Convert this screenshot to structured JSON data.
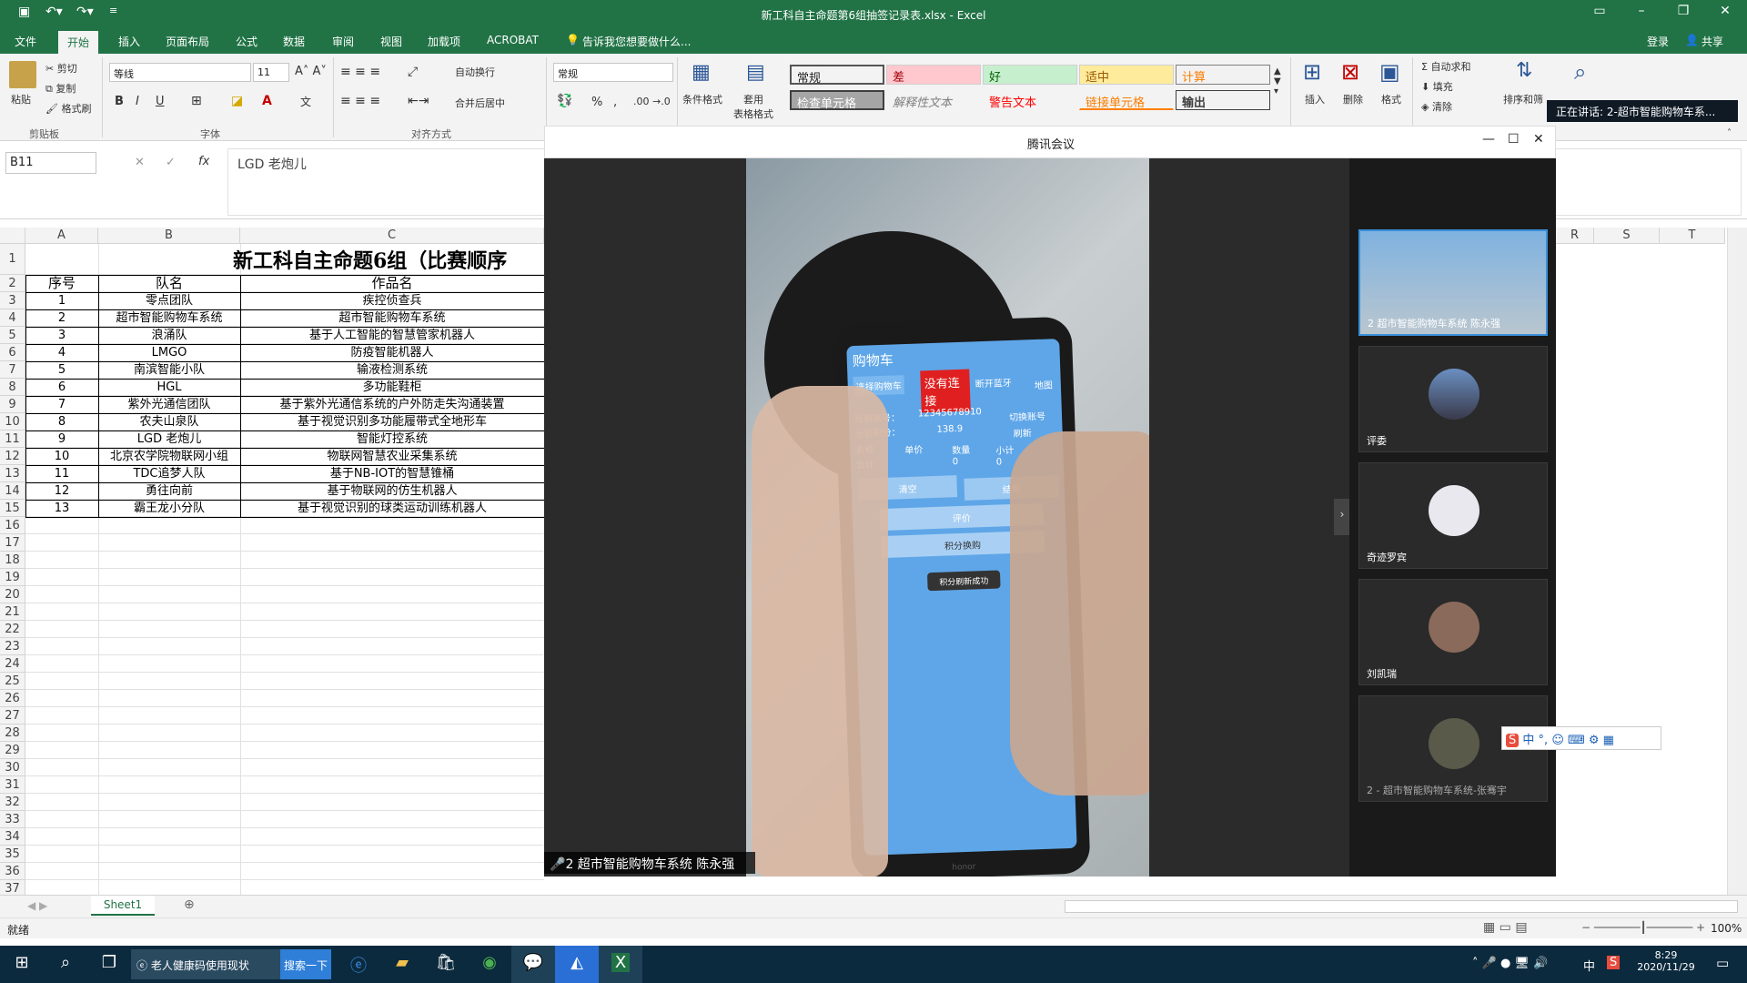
{
  "window": {
    "title": "新工科自主命题第6组抽签记录表.xlsx - Excel"
  },
  "tabs": [
    "文件",
    "开始",
    "插入",
    "页面布局",
    "公式",
    "数据",
    "审阅",
    "视图",
    "加载项",
    "ACROBAT"
  ],
  "tell_me": "告诉我您想要做什么...",
  "account": {
    "login": "登录",
    "share": "共享"
  },
  "ribbon": {
    "clipboard": {
      "paste": "粘贴",
      "cut": "剪切",
      "copy": "复制",
      "format_painter": "格式刷",
      "group": "剪贴板"
    },
    "font": {
      "name": "等线",
      "size": "11",
      "group": "字体",
      "bold": "B",
      "italic": "I",
      "underline": "U"
    },
    "alignment": {
      "wrap": "自动换行",
      "merge": "合并后居中",
      "group": "对齐方式"
    },
    "number": {
      "format": "常规",
      "percent": "%",
      "comma": ","
    },
    "styles": {
      "cond": "条件格式",
      "table": "套用\n表格格式",
      "items": [
        {
          "label": "常规",
          "bg": "#ffffff",
          "fg": "#000000"
        },
        {
          "label": "差",
          "bg": "#ffc7ce",
          "fg": "#9c0006"
        },
        {
          "label": "好",
          "bg": "#c6efce",
          "fg": "#006100"
        },
        {
          "label": "适中",
          "bg": "#ffeb9c",
          "fg": "#9c5700"
        },
        {
          "label": "计算",
          "bg": "#f2f2f2",
          "fg": "#fa7d00"
        },
        {
          "label": "检查单元格",
          "bg": "#a5a5a5",
          "fg": "#ffffff"
        },
        {
          "label": "解释性文本",
          "bg": "#ffffff",
          "fg": "#7f7f7f"
        },
        {
          "label": "警告文本",
          "bg": "#ffffff",
          "fg": "#ff0000"
        },
        {
          "label": "链接单元格",
          "bg": "#ffffff",
          "fg": "#fa7d00"
        },
        {
          "label": "输出",
          "bg": "#f2f2f2",
          "fg": "#3f3f3f"
        }
      ]
    },
    "cells": {
      "insert": "插入",
      "delete": "删除",
      "format": "格式"
    },
    "editing": {
      "autosum": "自动求和",
      "fill": "填充",
      "clear": "清除",
      "sort": "排序和筛"
    }
  },
  "speaking": "正在讲话: 2-超市智能购物车系...",
  "namebox": "B11",
  "formula": "LGD 老炮儿",
  "columns": {
    "a": "A",
    "b": "B",
    "c": "C",
    "r": "R",
    "s": "S",
    "t": "T"
  },
  "sheet": {
    "title": "新工科自主命题6组（比赛顺序",
    "headers": [
      "序号",
      "队名",
      "作品名"
    ],
    "rows": [
      [
        "1",
        "零点团队",
        "疾控侦查兵"
      ],
      [
        "2",
        "超市智能购物车系统",
        "超市智能购物车系统"
      ],
      [
        "3",
        "浪涌队",
        "基于人工智能的智慧管家机器人"
      ],
      [
        "4",
        "LMGO",
        "防疫智能机器人"
      ],
      [
        "5",
        "南滨智能小队",
        "输液检测系统"
      ],
      [
        "6",
        "HGL",
        "多功能鞋柜"
      ],
      [
        "7",
        "紫外光通信团队",
        "基于紫外光通信系统的户外防走失沟通装置"
      ],
      [
        "8",
        "农夫山泉队",
        "基于视觉识别多功能履带式全地形车"
      ],
      [
        "9",
        "LGD 老炮儿",
        "智能灯控系统"
      ],
      [
        "10",
        "北京农学院物联网小组",
        "物联网智慧农业采集系统"
      ],
      [
        "11",
        "TDC追梦人队",
        "基于NB-IOT的智慧锥桶"
      ],
      [
        "12",
        "勇往向前",
        "基于物联网的仿生机器人"
      ],
      [
        "13",
        "霸王龙小分队",
        "基于视觉识别的球类运动训练机器人"
      ]
    ]
  },
  "row_numbers": [
    "1",
    "2",
    "3",
    "4",
    "5",
    "6",
    "7",
    "8",
    "9",
    "10",
    "11",
    "12",
    "13",
    "14",
    "15",
    "16",
    "17",
    "18",
    "19",
    "20",
    "21",
    "22",
    "23",
    "24",
    "25",
    "26",
    "27",
    "28",
    "29",
    "30",
    "31",
    "32",
    "33",
    "34",
    "35",
    "36",
    "37"
  ],
  "meeting": {
    "title": "腾讯会议",
    "main_label": "2 超市智能购物车系统 陈永强",
    "participants": [
      "2 超市智能购物车系统 陈永强",
      "评委",
      "奇迹罗宾",
      "刘凯瑞",
      "2 - 超市智能购物车系统-张骞宇"
    ],
    "phone": {
      "title": "购物车",
      "tabs": [
        "选择购物车",
        "没有连接",
        "断开蓝牙",
        "地图"
      ],
      "account_label": "当前账号：",
      "account": "12345678910",
      "switch": "切换账号",
      "points_label": "当前积分：",
      "points": "138.9",
      "refresh": "刷新",
      "cols": [
        "名称",
        "单价",
        "数量",
        "小计"
      ],
      "total": "合计",
      "zero1": "0",
      "zero2": "0",
      "clear": "清空",
      "pay": "结算",
      "eval": "评价",
      "exchange": "积分换购",
      "toast": "积分刷新成功",
      "brand": "honor"
    }
  },
  "ime": "中",
  "sheet_tab": "Sheet1",
  "status_text": "就绪",
  "zoom": "100%",
  "taskbar": {
    "app1": "老人健康码使用现状",
    "search_btn": "搜索一下",
    "time": "8:29",
    "date": "2020/11/29",
    "lang": "中"
  }
}
